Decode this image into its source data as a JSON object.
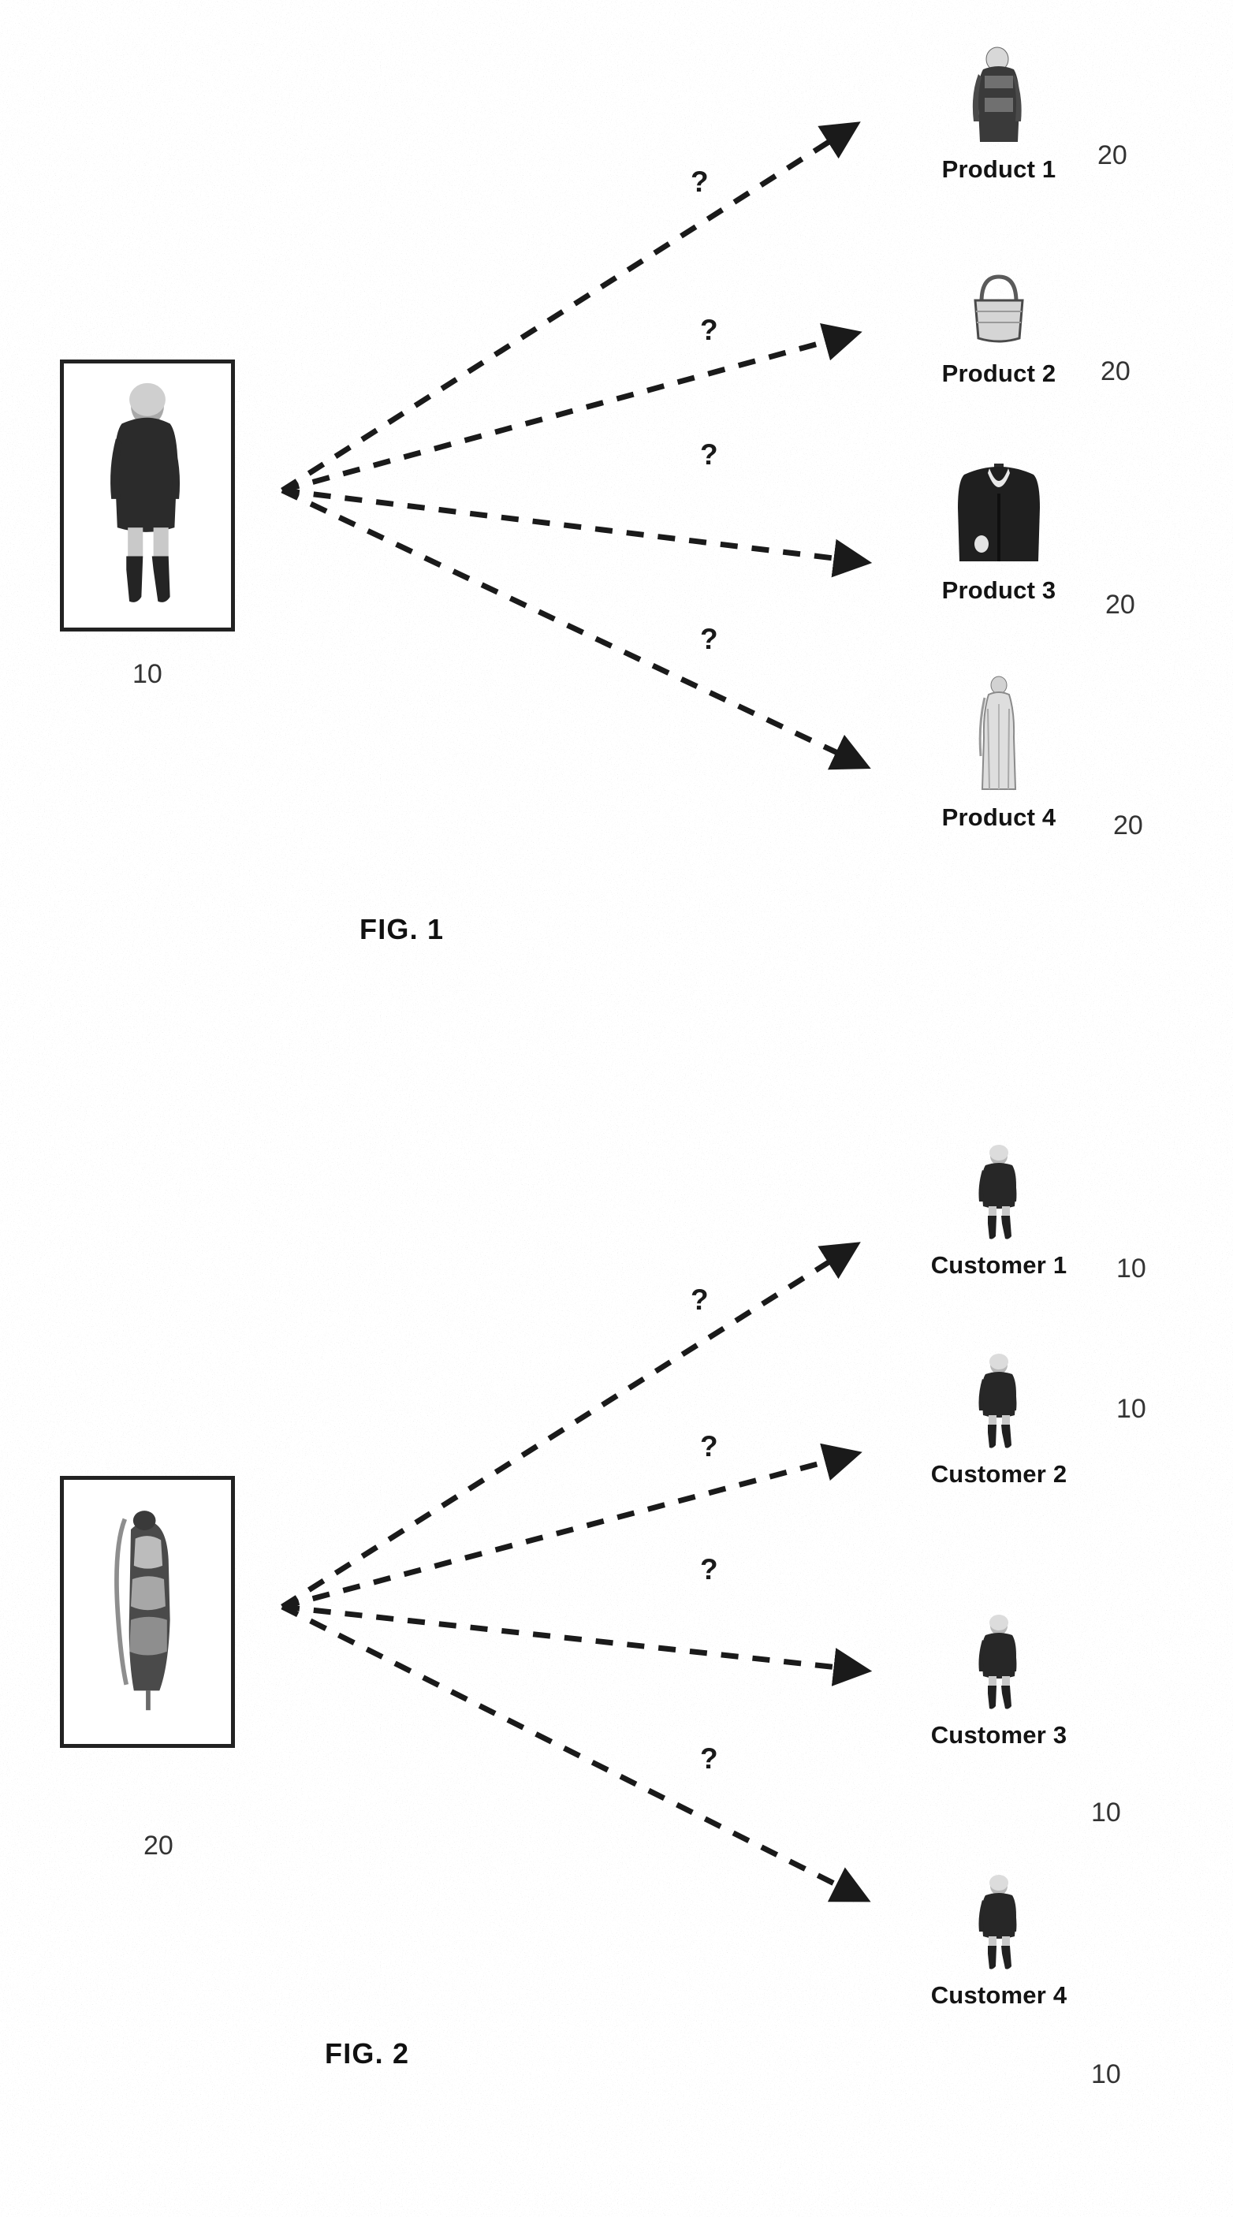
{
  "document": {
    "kind": "patent-drawing-sheet",
    "figures": [
      {
        "id": "fig1",
        "caption": "FIG. 1",
        "source": {
          "ref": "10",
          "subject": "customer",
          "icon": "woman-in-dark-coat-and-boots"
        },
        "connector_label": "?",
        "targets": [
          {
            "caption": "Product 1",
            "ref": "20",
            "icon": "woman-in-patterned-outfit"
          },
          {
            "caption": "Product 2",
            "ref": "20",
            "icon": "handbag"
          },
          {
            "caption": "Product 3",
            "ref": "20",
            "icon": "dark-blazer-jacket"
          },
          {
            "caption": "Product 4",
            "ref": "20",
            "icon": "long-light-gown"
          }
        ]
      },
      {
        "id": "fig2",
        "caption": "FIG. 2",
        "source": {
          "ref": "20",
          "subject": "product",
          "icon": "dress-on-mannequin"
        },
        "connector_label": "?",
        "targets": [
          {
            "caption": "Customer 1",
            "ref": "10",
            "icon": "woman-in-dark-coat-and-boots"
          },
          {
            "caption": "Customer 2",
            "ref": "10",
            "icon": "woman-in-dark-coat-and-boots"
          },
          {
            "caption": "Customer 3",
            "ref": "10",
            "icon": "woman-in-dark-coat-and-boots"
          },
          {
            "caption": "Customer 4",
            "ref": "10",
            "icon": "woman-in-dark-coat-and-boots"
          }
        ]
      }
    ],
    "colors": {
      "ink": "#1a1a1a",
      "ref_number": "#333333",
      "background": "#ffffff",
      "frame": "#222222"
    }
  }
}
